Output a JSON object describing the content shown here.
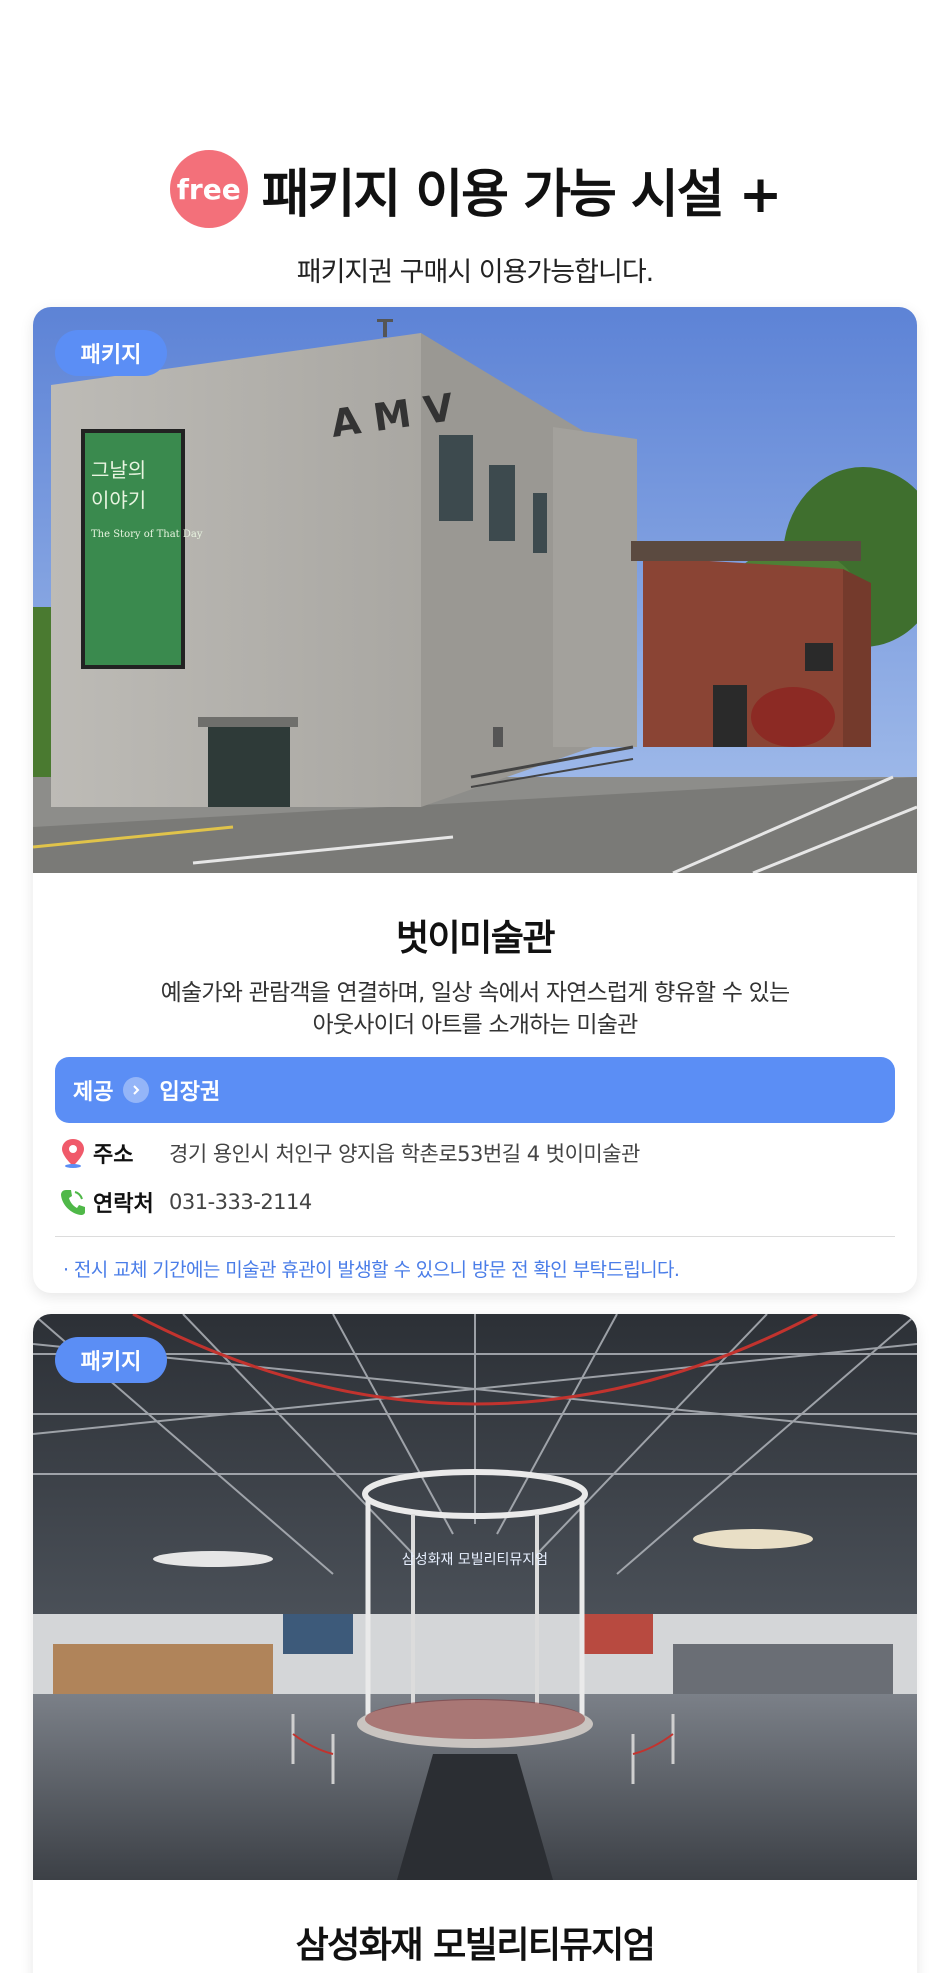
{
  "hero": {
    "badge": "free",
    "title": "패키지 이용 가능 시설 +",
    "subtitle": "패키지권 구매시 이용가능합니다."
  },
  "cards": [
    {
      "badge": "패키지",
      "photo_sign": "AMV",
      "poster_title": "그날의 이야기",
      "poster_subtitle": "The Story of That Day",
      "title": "벗이미술관",
      "desc_line1": "예술가와 관람객을 연결하며, 일상 속에서 자연스럽게 향유할 수 있는",
      "desc_line2": "아웃사이더 아트를 소개하는 미술관",
      "offer_label": "제공",
      "offer_value": "입장권",
      "address_label": "주소",
      "address_value": "경기 용인시 처인구 양지읍 학촌로53번길 4 벗이미술관",
      "tel_label": "연락처",
      "tel_value": "031-333-2114",
      "notice": "· 전시 교체 기간에는 미술관 휴관이 발생할 수 있으니 방문 전 확인 부탁드립니다."
    },
    {
      "badge": "패키지",
      "photo_sign": "삼성화재 모빌리티뮤지엄",
      "title": "삼성화재 모빌리티뮤지엄"
    }
  ],
  "colors": {
    "accent_blue": "#5b8ef5",
    "free_pink": "#f3707a",
    "notice_blue": "#4a7de8"
  },
  "icons": {
    "pin": "map-pin-icon",
    "phone": "phone-icon",
    "arrow": "chevron-right-icon"
  }
}
